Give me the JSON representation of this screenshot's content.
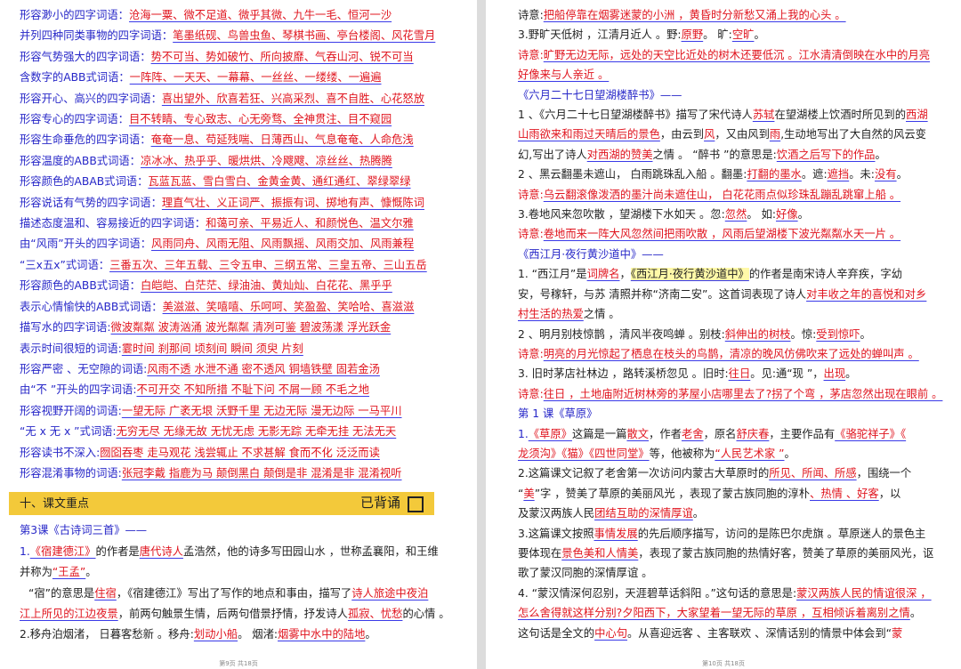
{
  "left_page": {
    "vocab": [
      {
        "label": "形容渺小的四字词语：",
        "items": "沧海一粟、微不足道、微乎其微、九牛一毛、恒河一沙"
      },
      {
        "label": "并列四种同类事物的四字词语：",
        "items": "笔墨纸砚、鸟兽虫鱼、琴棋书画、亭台楼阁、风花雪月"
      },
      {
        "label": "形容气势强大的四字词语：",
        "items": "势不可当、势如破竹、所向披靡、气吞山河、锐不可当"
      },
      {
        "label": "含数字的ABB式词语：",
        "items": "一阵阵、一天天、一幕幕、一丝丝、一缕缕、一遍遍"
      },
      {
        "label": "形容开心、高兴的四字词语：",
        "items": "喜出望外、欣喜若狂、兴高采烈、喜不自胜、心花怒放"
      },
      {
        "label": "形容专心的四字词语：",
        "items": "目不转睛、专心致志、心无旁骛、全神贯注、目不窥园"
      },
      {
        "label": "形容生命垂危的四字词语：",
        "items": "奄奄一息、苟延残喘、日薄西山、气息奄奄、人命危浅"
      },
      {
        "label": "形容温度的ABB式词语：",
        "items": "凉冰冰、热乎乎、暖烘烘、冷飕飕、凉丝丝、热腾腾"
      },
      {
        "label": "形容颜色的ABAB式词语：",
        "items": "瓦蓝瓦蓝、雪白雪白、金黄金黄、通红通红、翠绿翠绿"
      },
      {
        "label": "形容说话有气势的四字词语：",
        "items": "理直气壮、义正词严、振振有词、掷地有声、慷慨陈词"
      },
      {
        "label": "描述态度温和、容易接近的四字词语：",
        "items": "和蔼可亲、平易近人、和颜悦色、温文尔雅"
      },
      {
        "label": "由“风雨”开头的四字词语：",
        "items": "风雨同舟、风雨无阻、风雨飘摇、风雨交加、风雨兼程"
      },
      {
        "label": "“三x五x”式词语：",
        "items": "三番五次、三年五载、三令五申、三纲五常、三皇五帝、三山五岳"
      },
      {
        "label": "形容颜色的ABB式词语：",
        "items": "白皑皑、白茫茫、绿油油、黄灿灿、白花花、黑乎乎"
      },
      {
        "label": "表示心情愉快的ABB式词语：",
        "items": "美滋滋、笑嘻嘻、乐呵呵、笑盈盈、笑哈哈、喜滋滋"
      },
      {
        "label": "描写水的四字词语:",
        "items": "微波粼粼  波涛汹涌  波光粼粼  清冽可鉴  碧波荡漾  浮光跃金"
      },
      {
        "label": "表示时间很短的词语:",
        "items": "霎时间  刹那间  顷刻间  瞬间  须臾  片刻"
      },
      {
        "label": "形容严密 、无空隙的词语:",
        "items": "风雨不透  水泄不通  密不透风  铜墙铁壁  固若金汤"
      },
      {
        "label": "由“不 ”开头的四字词语:",
        "items": "不可开交  不知所措  不耻下问  不屑一顾  不毛之地"
      },
      {
        "label": "形容视野开阔的词语:",
        "items": "一望无际  广袤无垠  沃野千里  无边无际  漫无边际  一马平川"
      },
      {
        "label": "“无 x 无 x ”式词语:",
        "items": "无穷无尽  无缘无故  无忧无虑  无影无踪  无牵无挂  无法无天"
      },
      {
        "label": "形容读书不深入:",
        "items": "囫囵吞枣  走马观花  浅尝辄止  不求甚解  食而不化  泛泛而读"
      },
      {
        "label": "形容混淆事物的词语:",
        "items": "张冠李戴  指鹿为马  颠倒黑白  颠倒是非  混淆是非  混淆视听"
      }
    ],
    "section_title": "十、课文重点",
    "section_status": "已背诵",
    "lesson_title": "第3课《古诗词三首》——",
    "p1_a": "1.",
    "p1_b": "《宿建德江》",
    "p1_c": "的作者是",
    "p1_d": "唐代诗人",
    "p1_e": "孟浩然，他的诗多写田园山水 ，世称孟襄阳，和王维",
    "p1_f": "并称为",
    "p1_g": "“王孟”",
    "p1_h": "。",
    "p2_a": "“宿”的意思是",
    "p2_b": "住宿",
    "p2_c": "，《宿建德江》写出了写作的地点和事由，描写了",
    "p2_d": "诗人旅途中夜泊",
    "p2_e": "江上所见的江边夜景",
    "p2_f": "，前两句触景生情，后两句借景抒情，抒发诗人",
    "p2_g": "孤寂、忧愁",
    "p2_h": "的心情 。",
    "p3_a": "2.移舟泊烟渚，  日暮客愁新 。移舟:",
    "p3_b": "划动小船",
    "p3_c": "。  烟渚:",
    "p3_d": "烟雾中水中的陆地",
    "p3_e": "。",
    "footer": "第9页  共18页"
  },
  "right_page": {
    "r1_a": "诗意:",
    "r1_b": "把船停靠在烟雾迷蒙的小洲 ，黄昏时分新愁又涌上我的心头 。",
    "r2_a": "3.野旷天低树 ，江清月近人 。野:",
    "r2_b": "原野",
    "r2_c": "。        旷:",
    "r2_d": "空旷",
    "r2_e": "。",
    "r3_a": "诗意:",
    "r3_b": "旷野无边无际，远处的天空比近处的树木还要低沉 。江水清清倒映在水中的月亮",
    "r3_c": "好像来与人亲近 。",
    "lesson2": "《六月二十七日望湖楼醉书》——",
    "r4_a": "1 、《六月二十七日望湖楼醉书》描写了宋代诗人",
    "r4_b": "苏轼",
    "r4_c": "在望湖楼上饮酒时所见到的",
    "r4_d": "西湖",
    "r4_e": "山雨欲来和雨过天晴后的景色",
    "r4_f": "，由云到",
    "r4_g": "风",
    "r4_h": "，又由风到",
    "r4_i": "雨",
    "r4_j": ",生动地写出了大自然的风云变",
    "r4_k": "幻,写出了诗人",
    "r4_l": "对西湖的赞美",
    "r4_m": "之情 。  “醉书 ”的意思是:",
    "r4_n": "饮酒之后写下的作品",
    "r4_o": "。",
    "r5_a": "2 、黑云翻墨未遮山，  白雨跳珠乱入船 。翻墨:",
    "r5_b": "打翻的墨水",
    "r5_c": "。遮:",
    "r5_d": "遮挡",
    "r5_e": "。未:",
    "r5_f": "没有",
    "r5_g": "。",
    "r6_a": "诗意:",
    "r6_b": "乌云翻滚像泼洒的墨汁尚未遮住山， 白花花雨点似珍珠乱蹦乱跳窜上船 。",
    "r7_a": "3.卷地风来忽吹散 ，望湖楼下水如天 。忽:",
    "r7_b": "忽然",
    "r7_c": "。  如:",
    "r7_d": "好像",
    "r7_e": "。",
    "r8_a": "诗意:",
    "r8_b": "卷地而来一阵大风忽然间把雨吹散 ，风雨后望湖楼下波光粼粼水天一片 。",
    "lesson3": "《西江月·夜行黄沙道中》——",
    "r9_a": "1. “西江月”是",
    "r9_b": "词牌名",
    "r9_c": "，",
    "r9_d": "《西江月·夜行黄沙道中》",
    "r9_e": "的作者是南宋诗人辛弃疾，字幼",
    "r10_a": "安，号稼轩，与苏 清照并称“济南二安”。这首词表现了诗人",
    "r10_b": "对丰收之年的喜悦和对乡",
    "r10_c": "村生活的热爱",
    "r10_d": "之情 。",
    "r11_a": "2 、明月别枝惊鹊 ，清风半夜鸣蝉 。别枝:",
    "r11_b": "斜伸出的树枝",
    "r11_c": "。惊:",
    "r11_d": "受到惊吓",
    "r11_e": "。",
    "r12_a": "诗意:",
    "r12_b": "明亮的月光惊起了栖息在枝头的鸟鹊，清凉的晚风仿佛吹来了远处的蝉叫声 。",
    "r13_a": "3. 旧时茅店社林边 ，路转溪桥忽见 。旧时:",
    "r13_b": "往日",
    "r13_c": "。见:通“现 ”，",
    "r13_d": "出现",
    "r13_e": "。",
    "r14_a": "诗意:",
    "r14_b": "往日 ，土地庙附近树林旁的茅屋小店哪里去了?拐了个弯 ，茅店忽然出现在眼前 。",
    "lesson4": "第 1 课《草原》",
    "r15_a": "1.",
    "r15_b": "《草原》",
    "r15_c": "这篇是一篇",
    "r15_d": "散文",
    "r15_e": "，作者",
    "r15_f": "老舍",
    "r15_g": "，原名",
    "r15_h": "舒庆春",
    "r15_i": "，主要作品有",
    "r15_j": "《骆驼祥子》",
    "r15_k": "《",
    "r16_a": "龙须沟》《猫》《四世同堂》",
    "r16_b": "等，他被称为",
    "r16_c": "“人民艺术家 ”",
    "r16_d": "。",
    "r17_a": "2.这篇课文记叙了老舍第一次访问内蒙古大草原时的",
    "r17_b": "所见、所闻、所感",
    "r17_c": "，围绕一个",
    "r18_a": "“",
    "r18_b": "美",
    "r18_c": "”字 ，赞美了草原的美丽风光 ，表现了蒙古族同胞的淳朴",
    "r18_d": "、热情 、好客",
    "r18_e": "，以",
    "r19_a": "及蒙汉两族人民",
    "r19_b": "团结互助的深情厚谊",
    "r19_c": "。",
    "r20_a": "3.这篇课文按照",
    "r20_b": "事情发展",
    "r20_c": "的先后顺序描写，访问的是陈巴尔虎旗 。草原迷人的景色主",
    "r21_a": "要体现在",
    "r21_b": "景色美和人情美",
    "r21_c": "，表现了蒙古族同胞的热情好客，赞美了草原的美丽风光，讴",
    "r22_a": "歌了蒙汉同胞的深情厚谊 。",
    "r23_a": "4. “蒙汉情深何忍别，天涯碧草话斜阳 。”这句话的意思是:",
    "r23_b": "蒙汉两族人民的情谊很深 ，",
    "r24_a": "怎么舍得就这样分别?夕阳西下，大家望着一望无际的草原 ，互相倾诉着离别之情",
    "r24_b": "。",
    "r25_a": "这句话是全文的",
    "r25_b": "中心句",
    "r25_c": "。从喜迎远客 、主客联欢 、深情话别的情景中体会到“",
    "r25_d": "蒙",
    "footer": "第10页  共18页"
  }
}
